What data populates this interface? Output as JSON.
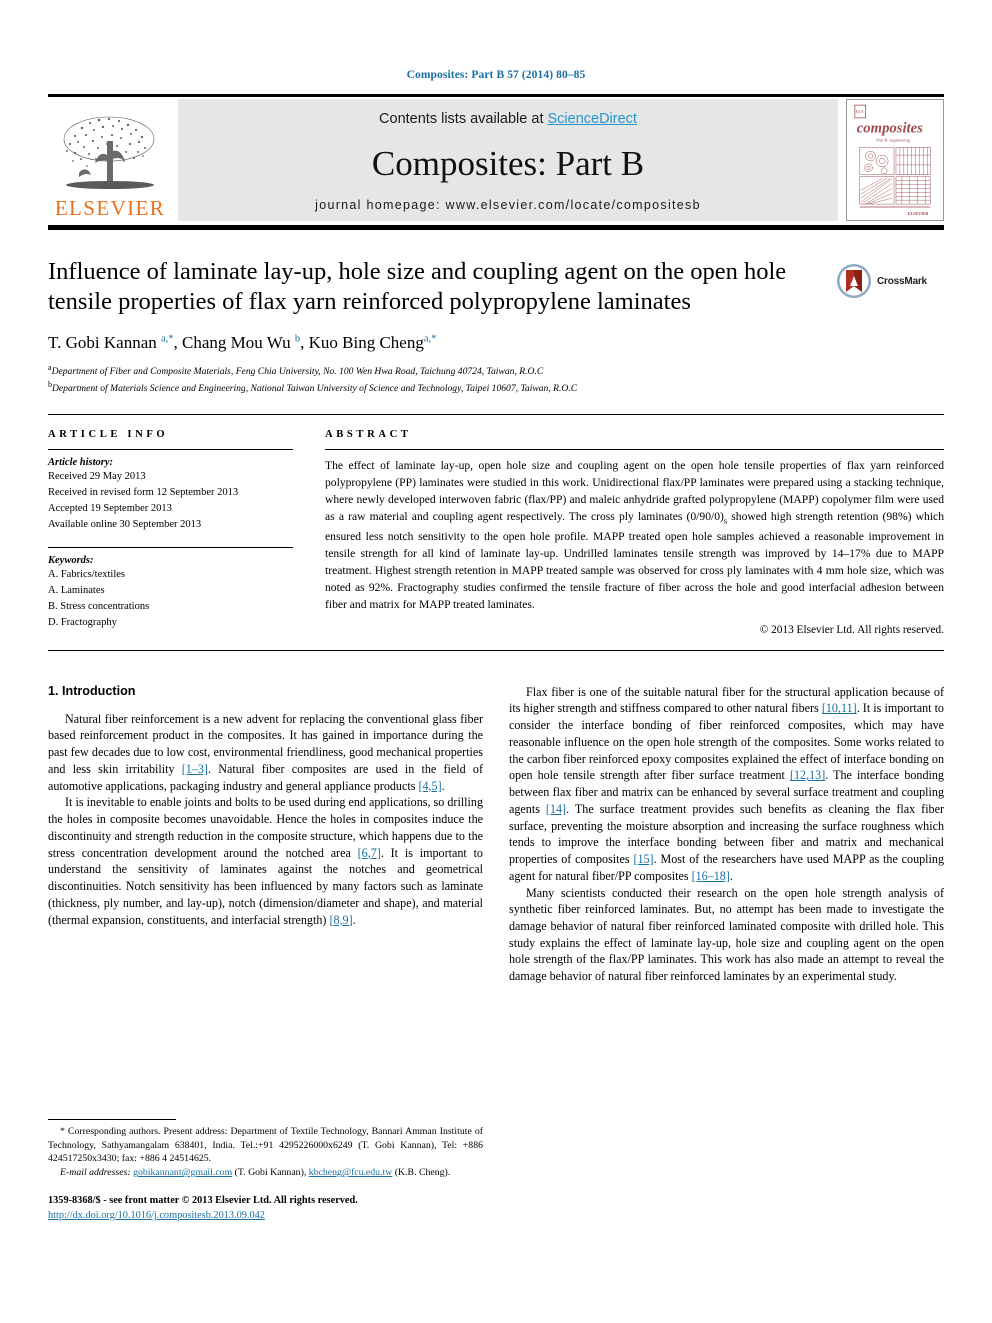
{
  "running_head": "Composites: Part B 57 (2014) 80–85",
  "masthead": {
    "contents_prefix": "Contents lists available at ",
    "sciencedirect_link": "ScienceDirect",
    "journal_title": "Composites: Part B",
    "homepage": "journal homepage: www.elsevier.com/locate/compositesb",
    "publisher_wordmark": "ELSEVIER",
    "cover_title": "composites",
    "cover_subtitle": "Part B: engineering"
  },
  "article": {
    "title": "Influence of laminate lay-up, hole size and coupling agent on the open hole tensile properties of flax yarn reinforced polypropylene laminates",
    "crossmark_label": "CrossMark",
    "authors_html": "T. Gobi Kannan <sup>a,*</sup>, Chang Mou Wu <sup>b</sup>, Kuo Bing Cheng<sup>a,*</sup>",
    "affiliations": [
      "Department of Fiber and Composite Materials, Feng Chia University, No. 100 Wen Hwa Road, Taichung 40724, Taiwan, R.O.C",
      "Department of Materials Science and Engineering, National Taiwan University of Science and Technology, Taipei 10607, Taiwan, R.O.C"
    ],
    "affiliation_marks": [
      "a",
      "b"
    ]
  },
  "article_info": {
    "heading": "ARTICLE INFO",
    "history_label": "Article history:",
    "history": [
      "Received 29 May 2013",
      "Received in revised form 12 September 2013",
      "Accepted 19 September 2013",
      "Available online 30 September 2013"
    ],
    "keywords_label": "Keywords:",
    "keywords": [
      "A. Fabrics/textiles",
      "A. Laminates",
      "B. Stress concentrations",
      "D. Fractography"
    ]
  },
  "abstract": {
    "heading": "ABSTRACT",
    "text_part1": "The effect of laminate lay-up, open hole size and coupling agent on the open hole tensile properties of flax yarn reinforced polypropylene (PP) laminates were studied in this work. Unidirectional flax/PP laminates were prepared using a stacking technique, where newly developed interwoven fabric (flax/PP) and maleic anhydride grafted polypropylene (MAPP) copolymer film were used as a raw material and coupling agent respectively. The cross ply laminates (0/90/0)",
    "subscript": "s",
    "text_part2": " showed high strength retention (98%) which ensured less notch sensitivity to the open hole profile. MAPP treated open hole samples achieved a reasonable improvement in tensile strength for all kind of laminate lay-up. Undrilled laminates tensile strength was improved by 14–17% due to MAPP treatment. Highest strength retention in MAPP treated sample was observed for cross ply laminates with 4 mm hole size, which was noted as 92%. Fractography studies confirmed the tensile fracture of fiber across the hole and good interfacial adhesion between fiber and matrix for MAPP treated laminates.",
    "copyright": "© 2013 Elsevier Ltd. All rights reserved."
  },
  "body": {
    "section_title": "1. Introduction",
    "left_paragraphs": [
      {
        "segments": [
          {
            "t": "Natural fiber reinforcement is a new advent for replacing the conventional glass fiber based reinforcement product in the composites. It has gained in importance during the past few decades due to low cost, environmental friendliness, good mechanical properties and less skin irritability ",
            "ref": false
          },
          {
            "t": "[1–3]",
            "ref": true
          },
          {
            "t": ". Natural fiber composites are used in the field of automotive applications, packaging industry and general appliance products ",
            "ref": false
          },
          {
            "t": "[4,5]",
            "ref": true
          },
          {
            "t": ".",
            "ref": false
          }
        ]
      },
      {
        "segments": [
          {
            "t": "It is inevitable to enable joints and bolts to be used during end applications, so drilling the holes in composite becomes unavoidable. Hence the holes in composites induce the discontinuity and strength reduction in the composite structure, which happens due to the stress concentration development around the notched area ",
            "ref": false
          },
          {
            "t": "[6,7]",
            "ref": true
          },
          {
            "t": ". It is important to understand the sensitivity of laminates against the notches and geometrical discontinuities. Notch sensitivity has been influenced by many factors such as laminate (thickness, ply number, and lay-up), notch (dimension/diameter and shape), and material (thermal expansion, constituents, and interfacial strength) ",
            "ref": false
          },
          {
            "t": "[8,9]",
            "ref": true
          },
          {
            "t": ".",
            "ref": false
          }
        ]
      }
    ],
    "right_paragraphs": [
      {
        "segments": [
          {
            "t": "Flax fiber is one of the suitable natural fiber for the structural application because of its higher strength and stiffness compared to other natural fibers ",
            "ref": false
          },
          {
            "t": "[10,11]",
            "ref": true
          },
          {
            "t": ". It is important to consider the interface bonding of fiber reinforced composites, which may have reasonable influence on the open hole strength of the composites. Some works related to the carbon fiber reinforced epoxy composites explained the effect of interface bonding on open hole tensile strength after fiber surface treatment ",
            "ref": false
          },
          {
            "t": "[12,13]",
            "ref": true
          },
          {
            "t": ". The interface bonding between flax fiber and matrix can be enhanced by several surface treatment and coupling agents ",
            "ref": false
          },
          {
            "t": "[14]",
            "ref": true
          },
          {
            "t": ". The surface treatment provides such benefits as cleaning the flax fiber surface, preventing the moisture absorption and increasing the surface roughness which tends to improve the interface bonding between fiber and matrix and mechanical properties of composites ",
            "ref": false
          },
          {
            "t": "[15]",
            "ref": true
          },
          {
            "t": ". Most of the researchers have used MAPP as the coupling agent for natural fiber/PP composites ",
            "ref": false
          },
          {
            "t": "[16–18]",
            "ref": true
          },
          {
            "t": ".",
            "ref": false
          }
        ]
      },
      {
        "segments": [
          {
            "t": "Many scientists conducted their research on the open hole strength analysis of synthetic fiber reinforced laminates. But, no attempt has been made to investigate the damage behavior of natural fiber reinforced laminated composite with drilled hole. This study explains the effect of laminate lay-up, hole size and coupling agent on the open hole strength of the flax/PP laminates. This work has also made an attempt to reveal the damage behavior of natural fiber reinforced laminates by an experimental study.",
            "ref": false
          }
        ]
      }
    ]
  },
  "footnotes": {
    "corresponding": "* Corresponding authors. Present address: Department of Textile Technology, Bannari Amman Institute of Technology, Sathyamangalam 638401, India. Tel.:+91 4295226000x6249 (T. Gobi Kannan), Tel: +886 424517250x3430; fax: +886 4 24514625.",
    "email_label": "E-mail addresses:",
    "email_1": "gobikannant@gmail.com",
    "email_1_owner": " (T. Gobi Kannan), ",
    "email_2": "kbcheng@fcu.edu.tw",
    "email_2_owner": " (K.B. Cheng).",
    "issn_line": "1359-8368/$ - see front matter © 2013 Elsevier Ltd. All rights reserved.",
    "doi": "http://dx.doi.org/10.1016/j.compositesb.2013.09.042"
  },
  "colors": {
    "link_blue": "#1a6fa3",
    "sciencedirect_blue": "#2196d0",
    "elsevier_orange": "#E9711C",
    "cover_maroon": "#9e4a52",
    "masthead_gray": "#e6e6e6"
  }
}
